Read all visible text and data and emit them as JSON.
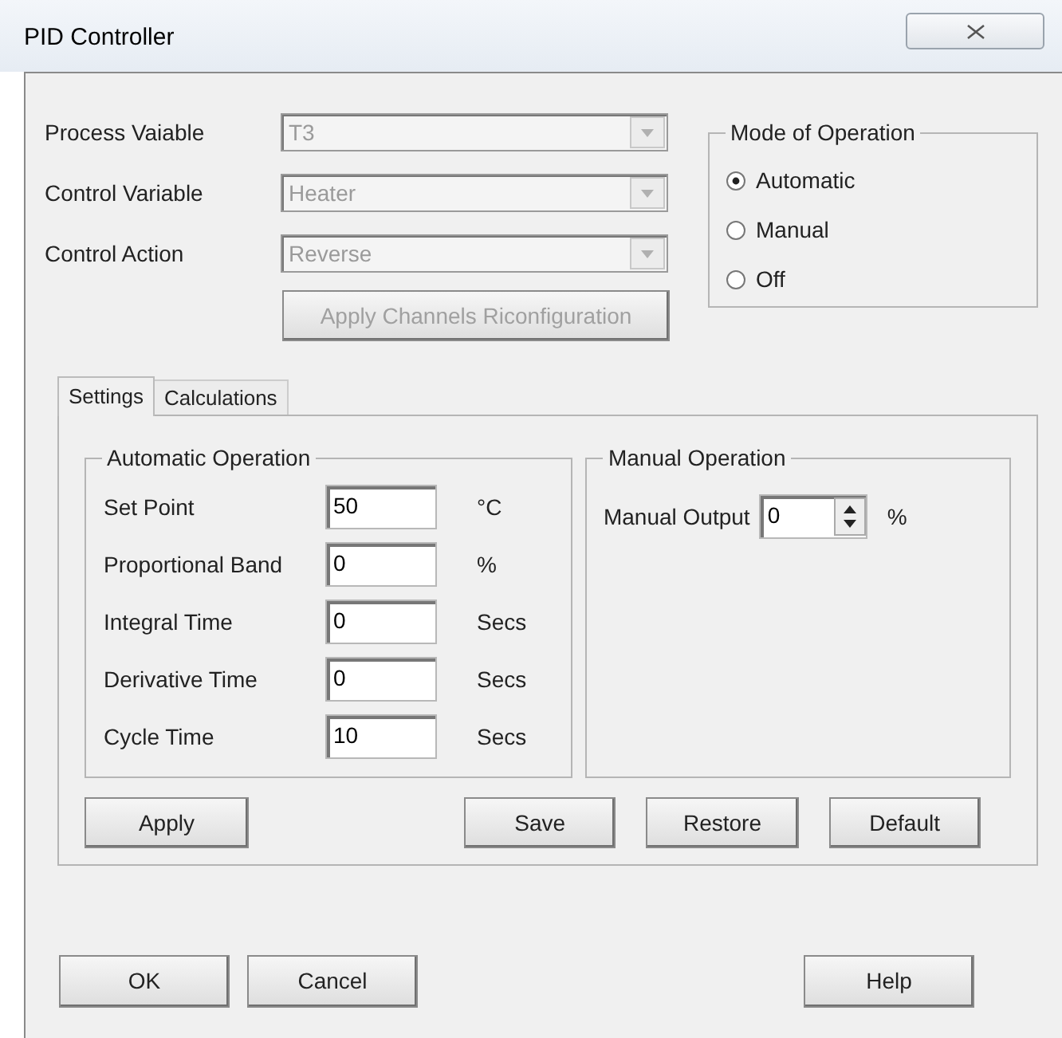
{
  "window": {
    "title": "PID Controller"
  },
  "channel_fields": [
    {
      "label": "Process Vaiable",
      "value": "T3",
      "disabled": true
    },
    {
      "label": "Control Variable",
      "value": "Heater",
      "disabled": true
    },
    {
      "label": "Control Action",
      "value": "Reverse",
      "disabled": true
    }
  ],
  "reconfigure_button": {
    "label": "Apply Channels Riconfiguration",
    "disabled": true
  },
  "mode_of_operation": {
    "title": "Mode of Operation",
    "options": [
      {
        "label": "Automatic",
        "selected": true
      },
      {
        "label": "Manual",
        "selected": false
      },
      {
        "label": "Off",
        "selected": false
      }
    ]
  },
  "tabs": [
    {
      "label": "Settings",
      "selected": true
    },
    {
      "label": "Calculations",
      "selected": false
    }
  ],
  "automatic_operation": {
    "title": "Automatic Operation",
    "fields": [
      {
        "label": "Set Point",
        "value": "50",
        "unit": "°C"
      },
      {
        "label": "Proportional Band",
        "value": "0",
        "unit": "%"
      },
      {
        "label": "Integral Time",
        "value": "0",
        "unit": "Secs"
      },
      {
        "label": "Derivative Time",
        "value": "0",
        "unit": "Secs"
      },
      {
        "label": "Cycle Time",
        "value": "10",
        "unit": "Secs"
      }
    ]
  },
  "manual_operation": {
    "title": "Manual Operation",
    "field": {
      "label": "Manual Output",
      "value": "0",
      "unit": "%"
    }
  },
  "panel_buttons": [
    "Apply",
    "Save",
    "Restore",
    "Default"
  ],
  "dialog_buttons": [
    "OK",
    "Cancel",
    "Help"
  ]
}
